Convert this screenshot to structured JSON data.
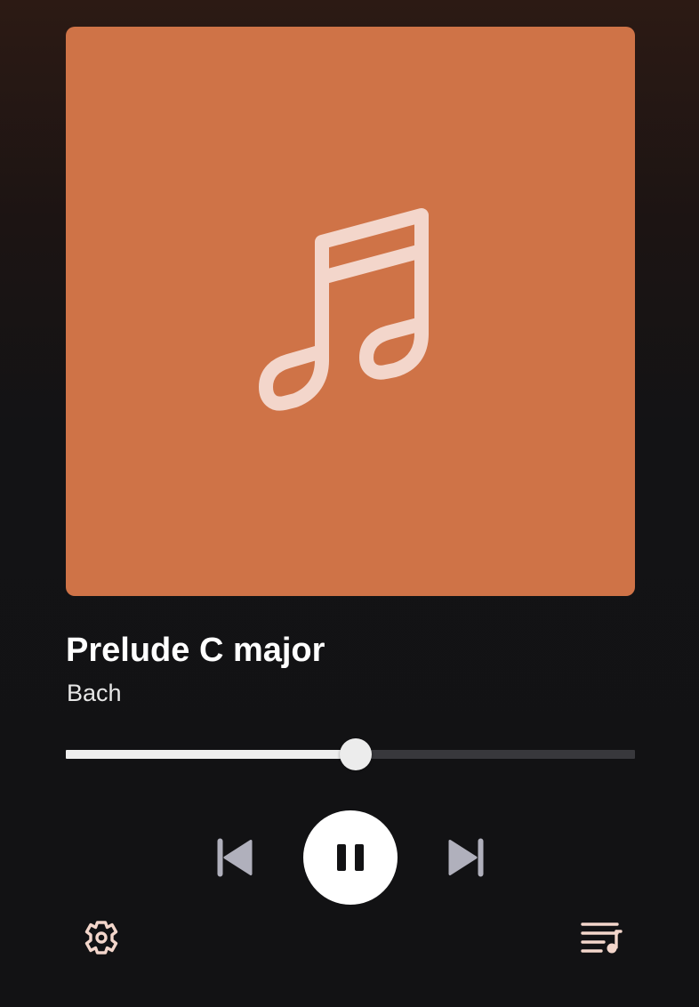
{
  "track": {
    "title": "Prelude C major",
    "artist": "Bach"
  },
  "artwork": {
    "icon": "music-note-icon",
    "background_color": "#cf7347",
    "icon_color": "#f3d6cb"
  },
  "playback": {
    "progress": 0.51,
    "state": "playing"
  },
  "controls": {
    "previous_icon": "skip-previous-icon",
    "play_pause_icon": "pause-icon",
    "next_icon": "skip-next-icon",
    "settings_icon": "gear-icon",
    "queue_icon": "queue-music-icon"
  },
  "colors": {
    "accent": "#cf7347",
    "icon_peach": "#f3d6cb",
    "transport_icon": "#b0b0bc",
    "seek_fill": "#eeeeee",
    "seek_track": "#38383c"
  }
}
